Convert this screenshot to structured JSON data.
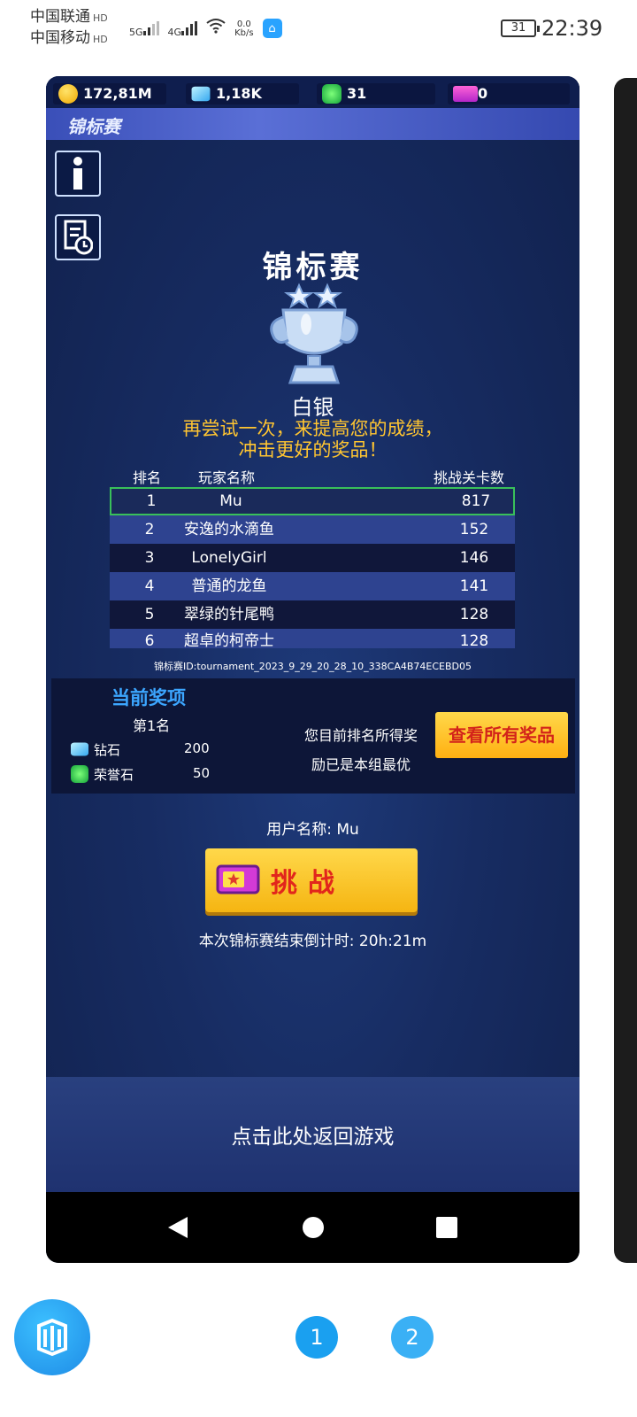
{
  "status": {
    "carrier1": "中国联通",
    "carrier2": "中国移动",
    "hd": "HD",
    "net1": "5G",
    "net2": "4G",
    "speed_value": "0.0",
    "speed_unit": "Kb/s",
    "battery": "31",
    "time": "22:39"
  },
  "resources": {
    "coins": "172,81M",
    "diamonds": "1,18K",
    "honor": "31",
    "tickets": "0"
  },
  "header": {
    "title": "锦标赛"
  },
  "tournament": {
    "title": "锦标赛",
    "tier": "白银",
    "message": "再尝试一次，来提高您的成绩，冲击更好的奖品！",
    "columns": {
      "rank": "排名",
      "name": "玩家名称",
      "score": "挑战关卡数"
    },
    "rows": [
      {
        "rank": "1",
        "name": "Mu",
        "score": "817"
      },
      {
        "rank": "2",
        "name": "安逸的水滴鱼",
        "score": "152"
      },
      {
        "rank": "3",
        "name": "LonelyGirl",
        "score": "146"
      },
      {
        "rank": "4",
        "name": "普通的龙鱼",
        "score": "141"
      },
      {
        "rank": "5",
        "name": "翠绿的针尾鸭",
        "score": "128"
      },
      {
        "rank": "6",
        "name": "超卓的柯帝士",
        "score": "128"
      }
    ],
    "id_text": "锦标赛ID:tournament_2023_9_29_20_28_10_338CA4B74ECEBD05"
  },
  "rewards": {
    "title": "当前奖项",
    "rank": "第1名",
    "items": [
      {
        "name": "钻石",
        "amount": "200"
      },
      {
        "name": "荣誉石",
        "amount": "50"
      }
    ],
    "note_line1": "您目前排名所得奖",
    "note_line2": "励已是本组最优",
    "view_all": "查看所有奖品"
  },
  "user": {
    "label": "用户名称: Mu"
  },
  "challenge": {
    "label": "挑战"
  },
  "countdown": "本次锦标赛结束倒计时: 20h:21m",
  "back": "点击此处返回游戏",
  "pages": [
    "1",
    "2"
  ],
  "colors": {
    "accent_yellow": "#ffc531",
    "accent_blue": "#3ca6ff",
    "row_highlight": "#39c05a"
  }
}
